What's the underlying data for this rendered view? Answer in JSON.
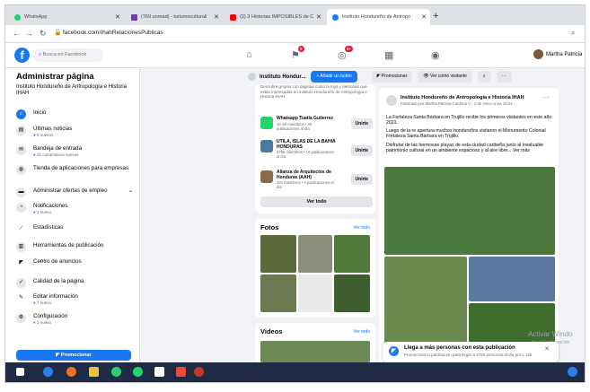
{
  "browser": {
    "tabs": [
      {
        "label": "WhatsApp",
        "color": "#25d366"
      },
      {
        "label": "(769 unread) - turismoculturali",
        "color": "#6b3fa0"
      },
      {
        "label": "(2) 3 Historias IMPOSIBLES de C",
        "color": "#ff0000"
      },
      {
        "label": "Instituto Hondureño de Antropo",
        "color": "#1877f2"
      }
    ],
    "url": "facebook.com/IhahRelacionesPublicas"
  },
  "fb": {
    "search_placeholder": "Busca en Facebook",
    "notif_badge_1": "9",
    "notif_badge_2": "9+",
    "user_name": "Martha Patricia"
  },
  "sidebar": {
    "title": "Administrar página",
    "page_name": "Instituto Hondureño de Antropología e Historia IHAH",
    "items": [
      {
        "label": "Inicio",
        "sub": ""
      },
      {
        "label": "Últimas noticias",
        "sub": "8 nuevos"
      },
      {
        "label": "Bandeja de entrada",
        "sub": "21 comentarios nuevos"
      },
      {
        "label": "Tienda de aplicaciones para empresas",
        "sub": ""
      },
      {
        "label": "Administrar ofertas de empleo",
        "sub": ""
      },
      {
        "label": "Notificaciones",
        "sub": "1 nuevo"
      },
      {
        "label": "Estadísticas",
        "sub": ""
      },
      {
        "label": "Herramientas de publicación",
        "sub": ""
      },
      {
        "label": "Centro de anuncios",
        "sub": ""
      },
      {
        "label": "Calidad de la página",
        "sub": ""
      },
      {
        "label": "Editar información",
        "sub": "7 nuevo"
      },
      {
        "label": "Configuración",
        "sub": "1 nuevo"
      }
    ],
    "promote_label": "Promocionar"
  },
  "pagebar": {
    "name": "Instituto Hondur...",
    "add_button": "+ Añadir un botón",
    "promote": "Promocionar",
    "view_as": "Ver como visitante"
  },
  "groups": {
    "intro": "Descubre grupos con páginas como la tuya y personas que están interesadas en Instituto Hondureño de Antropología e Historia IHAH.",
    "items": [
      {
        "name": "Whatsapp Tuatla Gutierrez",
        "info": "16 mil miembros • 40 publicaciones al día",
        "join": "Unirte"
      },
      {
        "name": "UTILA, ISLAS DE LA BAHIA HONDURAS",
        "info": "2786 miembros • 10 publicaciones al día",
        "join": "Unirte"
      },
      {
        "name": "Alianza de Arquitectos de Honduras (AAH)",
        "info": "334 miembros • 4 publicaciones al día",
        "join": "Unirte"
      }
    ],
    "see_all": "Ver todo"
  },
  "photos": {
    "title": "Fotos",
    "link": "Ver todo"
  },
  "videos": {
    "title": "Videos",
    "link": "Ver todo"
  },
  "post": {
    "author": "Instituto Hondureño de Antropología e Historia IHAH",
    "meta": "Publicado por Martha Patricia Cardona V · 2 de enero a las 10:24 ·",
    "p1": "La Fortaleza Santa Bárbara en Trujillo recibe los primeros visitantes en este año 2021.",
    "p2": "Luego de la re apertura muchos hondureños visitaron el Monumento Colonial Fortaleza Santa Bárbara en Trujillo.",
    "p3": "Disfrutar de las hermosas playas de esta ciudad caribeña junto al invaluable patrimonio cultural en un ambiente espacioso y al aire libre... Ver más"
  },
  "boost": {
    "title": "Llega a más personas con esta publicación",
    "sub": "Promociona tu publicación para llegar a 2752 personas al día por L 125"
  },
  "watermark": {
    "line1": "Activar Windo",
    "line2": "Ve a Configuración"
  }
}
